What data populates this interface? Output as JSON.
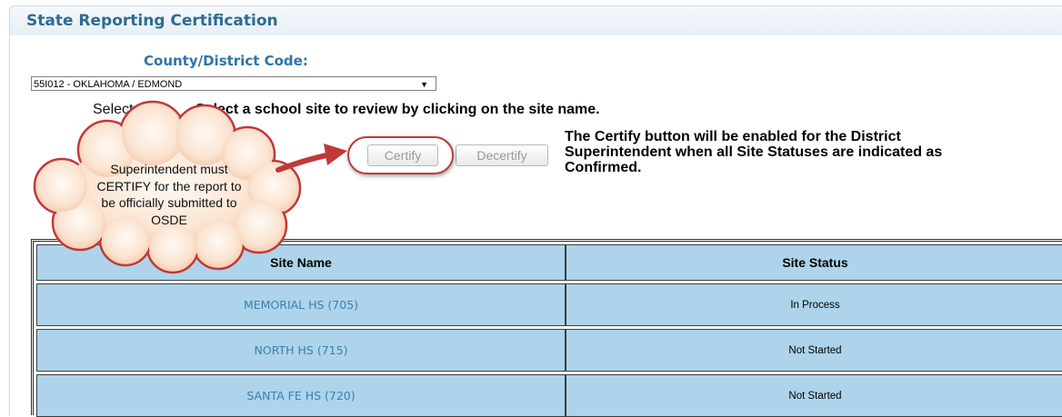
{
  "page": {
    "title": "State Reporting Certification"
  },
  "county": {
    "label": "County/District Code:",
    "selected": "55I012 - OKLAHOMA / EDMOND"
  },
  "site": {
    "select_label": "Select Site",
    "instruction": "Select a school site to review by clicking on the site name."
  },
  "buttons": {
    "certify": "Certify",
    "decertify": "Decertify"
  },
  "note": {
    "lines": [
      "The Certify button will be enabled for the District",
      "Superintendent when all Site Statuses are indicated as",
      "Confirmed."
    ]
  },
  "callout": {
    "lines": [
      "Superintendent must",
      "CERTIFY for the report to",
      "be officially submitted to",
      "OSDE"
    ],
    "fill": "#fbe3d0",
    "border": "#c0393a",
    "arrow_color": "#c0393a"
  },
  "table": {
    "headers": [
      "Site Name",
      "Site Status"
    ],
    "rows": [
      {
        "name": "MEMORIAL HS (705)",
        "status": "In Process"
      },
      {
        "name": "NORTH HS (715)",
        "status": "Not Started"
      },
      {
        "name": "SANTA FE HS (720)",
        "status": "Not Started"
      }
    ]
  },
  "colors": {
    "title": "#2f6b93",
    "label": "#2e74a8",
    "table_cell": "#add4ea",
    "link": "#3a7fb0"
  }
}
